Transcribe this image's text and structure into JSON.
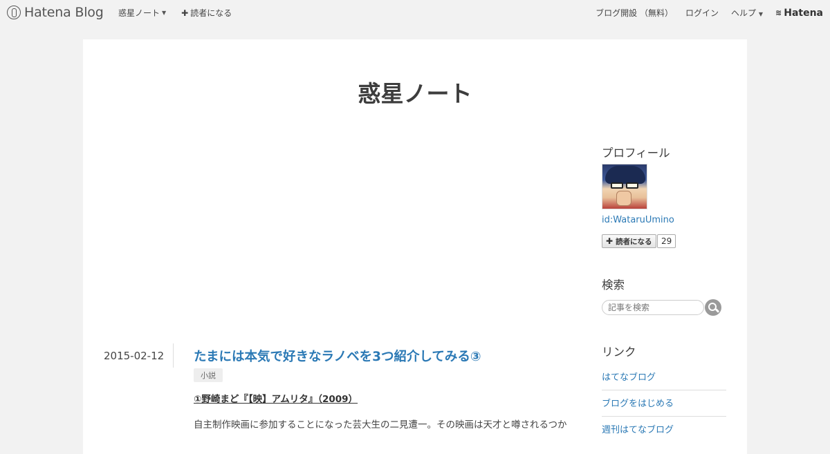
{
  "topbar": {
    "brand": "Hatena Blog",
    "blog_menu": "惑星ノート",
    "subscribe": "読者になる",
    "open_blog": "ブログ開設 （無料）",
    "login": "ログイン",
    "help": "ヘルプ",
    "hatena": "Hatena"
  },
  "blog": {
    "title": "惑星ノート"
  },
  "entry": {
    "date": "2015-02-12",
    "title": "たまには本気で好きなラノベを3つ紹介してみる③",
    "category": "小説",
    "subheading": "①野崎まど『【映】アムリタ』（2009）",
    "body": "自主制作映画に参加することになった芸大生の二見遭一。その映画は天才と噂されるつか"
  },
  "sidebar": {
    "profile_heading": "プロフィール",
    "user_id": "id:WataruUmino",
    "subscribe_button": "読者になる",
    "subscriber_count": "29",
    "search_heading": "検索",
    "search_placeholder": "記事を検索",
    "links_heading": "リンク",
    "links": [
      "はてなブログ",
      "ブログをはじめる",
      "週刊はてなブログ"
    ]
  }
}
